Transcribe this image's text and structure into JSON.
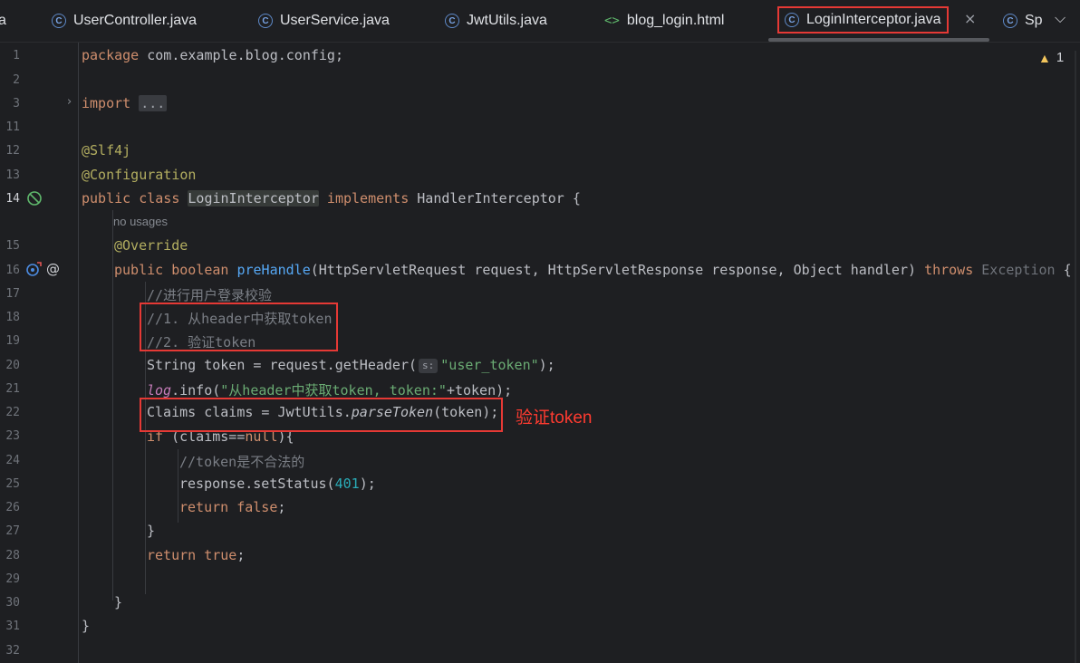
{
  "tabs": [
    {
      "label": "a",
      "icon": "c-class-icon"
    },
    {
      "label": "UserController.java",
      "icon": "c-class-icon"
    },
    {
      "label": "UserService.java",
      "icon": "c-class-icon"
    },
    {
      "label": "JwtUtils.java",
      "icon": "c-class-icon"
    },
    {
      "label": "blog_login.html",
      "icon": "html-icon"
    },
    {
      "label": "LoginInterceptor.java",
      "icon": "c-class-icon",
      "active": true
    },
    {
      "label": "Sp",
      "icon": "c-class-icon"
    }
  ],
  "tab_close_glyph": "×",
  "tabs_dropdown_glyph": "⌵",
  "warnings": {
    "icon": "warning-triangle-icon",
    "count": "1"
  },
  "line_numbers": [
    "1",
    "2",
    "3",
    "11",
    "12",
    "13",
    "14",
    "",
    "15",
    "16",
    "17",
    "18",
    "19",
    "20",
    "21",
    "22",
    "23",
    "24",
    "25",
    "26",
    "27",
    "28",
    "29",
    "30",
    "31",
    "32"
  ],
  "code": {
    "l1_kw": "package",
    "l1_rest": " com.example.blog.config;",
    "l3_kw": "import",
    "l3_fold": "...",
    "l12": "@Slf4j",
    "l13": "@Configuration",
    "l14_kw1": "public class ",
    "l14_cls": "LoginInterceptor",
    "l14_kw2": " implements ",
    "l14_rest": "HandlerInterceptor {",
    "hint_no_usages": "no usages",
    "l15": "@Override",
    "l16_kw": "public boolean ",
    "l16_fn": "preHandle",
    "l16_params": "(HttpServletRequest request, HttpServletResponse response, Object handler) ",
    "l16_throws": "throws",
    "l16_exc": " Exception",
    "l16_end": " {",
    "l17": "//进行用户登录校验",
    "l18": "//1. 从header中获取token",
    "l19": "//2. 验证token",
    "l20_a": "String token = request.getHeader(",
    "l20_inlay": "s:",
    "l20_str": "\"user_token\"",
    "l20_b": ");",
    "l21_fld": "log",
    "l21_a": ".info(",
    "l21_str": "\"从header中获取token, token:\"",
    "l21_b": "+token);",
    "l22_a": "Claims claims = JwtUtils.",
    "l22_fn": "parseToken",
    "l22_b": "(token);",
    "l23_kw": "if",
    "l23_a": " (claims==",
    "l23_null": "null",
    "l23_b": "){",
    "l24": "//token是不合法的",
    "l25_a": "response.setStatus(",
    "l25_num": "401",
    "l25_b": ");",
    "l26_kw": "return false",
    "l26_b": ";",
    "l27": "}",
    "l28_kw": "return true",
    "l28_b": ";",
    "l30": "}",
    "l31": "}"
  },
  "annotation_note": "验证token",
  "colors": {
    "accent_red": "#e53935",
    "keyword": "#cf8e6d",
    "string": "#6aab73",
    "comment": "#7a7e85"
  }
}
